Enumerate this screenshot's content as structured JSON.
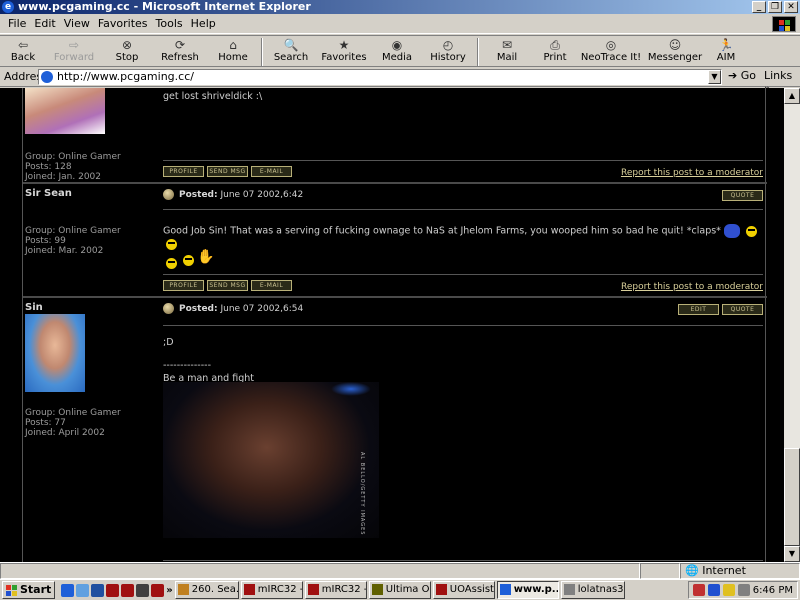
{
  "window": {
    "title": "www.pcgaming.cc - Microsoft Internet Explorer",
    "controls": [
      "_",
      "❐",
      "✕"
    ]
  },
  "menu": [
    "File",
    "Edit",
    "View",
    "Favorites",
    "Tools",
    "Help"
  ],
  "toolbar": [
    {
      "label": "Back",
      "icon": "back-arrow-icon",
      "glyph": "⇦",
      "enabled": true
    },
    {
      "label": "Forward",
      "icon": "forward-arrow-icon",
      "glyph": "⇨",
      "enabled": false
    },
    {
      "label": "Stop",
      "icon": "stop-icon",
      "glyph": "⊗",
      "enabled": true
    },
    {
      "label": "Refresh",
      "icon": "refresh-icon",
      "glyph": "⟳",
      "enabled": true
    },
    {
      "label": "Home",
      "icon": "home-icon",
      "glyph": "⌂",
      "enabled": true
    },
    {
      "label": "Search",
      "icon": "search-icon",
      "glyph": "🔍",
      "enabled": true
    },
    {
      "label": "Favorites",
      "icon": "favorites-icon",
      "glyph": "★",
      "enabled": true
    },
    {
      "label": "Media",
      "icon": "media-icon",
      "glyph": "◉",
      "enabled": true
    },
    {
      "label": "History",
      "icon": "history-icon",
      "glyph": "◴",
      "enabled": true
    },
    {
      "label": "Mail",
      "icon": "mail-icon",
      "glyph": "✉",
      "enabled": true
    },
    {
      "label": "Print",
      "icon": "print-icon",
      "glyph": "⎙",
      "enabled": true
    },
    {
      "label": "NeoTrace It!",
      "icon": "neotrace-icon",
      "glyph": "◎",
      "enabled": true
    },
    {
      "label": "Messenger",
      "icon": "messenger-icon",
      "glyph": "☺",
      "enabled": true
    },
    {
      "label": "AIM",
      "icon": "aim-running-man-icon",
      "glyph": "🏃",
      "enabled": true
    }
  ],
  "address": {
    "label": "Address",
    "url": "http://www.pcgaming.cc/",
    "go": "Go",
    "links": "Links"
  },
  "posts": [
    {
      "author": "",
      "group": "Group: Online Gamer",
      "posts": "Posts: 128",
      "joined": "Joined: Jan. 2002",
      "posted_label": "",
      "posted_date": "",
      "body": "get lost shriveldick :\\",
      "buttons": [
        "PROFILE",
        "SEND MSG",
        "E-MAIL"
      ],
      "report": "Report this post to a moderator"
    },
    {
      "author": "Sir Sean",
      "group": "Group: Online Gamer",
      "posts": "Posts: 99",
      "joined": "Joined: Mar. 2002",
      "posted_label": "Posted:",
      "posted_date": "June 07 2002,6:42",
      "body": "Good Job Sin! That was a serving of fucking ownage to NaS at Jhelom Farms, you wooped him so bad he quit! *claps*",
      "buttons": [
        "PROFILE",
        "SEND MSG",
        "E-MAIL"
      ],
      "right_buttons": [
        "QUOTE"
      ],
      "report": "Report this post to a moderator"
    },
    {
      "author": "Sin",
      "group": "Group: Online Gamer",
      "posts": "Posts: 77",
      "joined": "Joined: April 2002",
      "posted_label": "Posted:",
      "posted_date": "June 07 2002,6:54",
      "body_line1": ";D",
      "sig_rule": "--------------",
      "sig_text": "Be a man and fight",
      "image_credit": "AL BELLO/GETTY IMAGES",
      "right_buttons": [
        "EDIT",
        "QUOTE"
      ]
    }
  ],
  "status": {
    "zone": "Internet"
  },
  "taskbar": {
    "start": "Start",
    "tasks": [
      {
        "label": "260. Sea...",
        "color": "#c08020"
      },
      {
        "label": "mIRC32 - ...",
        "color": "#a01010"
      },
      {
        "label": "mIRC32 - ...",
        "color": "#a01010"
      },
      {
        "label": "Ultima On...",
        "color": "#606000"
      },
      {
        "label": "UOAssist ...",
        "color": "#a01010"
      },
      {
        "label": "www.p...",
        "color": "#1e5fd8",
        "active": true
      },
      {
        "label": "lolatnas3 ...",
        "color": "#808080"
      }
    ],
    "clock": "6:46 PM"
  },
  "colors": {
    "titlebar_start": "#0a246a",
    "titlebar_end": "#a6caf0",
    "forum_bg": "#000000",
    "link": "#d8cf9a"
  }
}
